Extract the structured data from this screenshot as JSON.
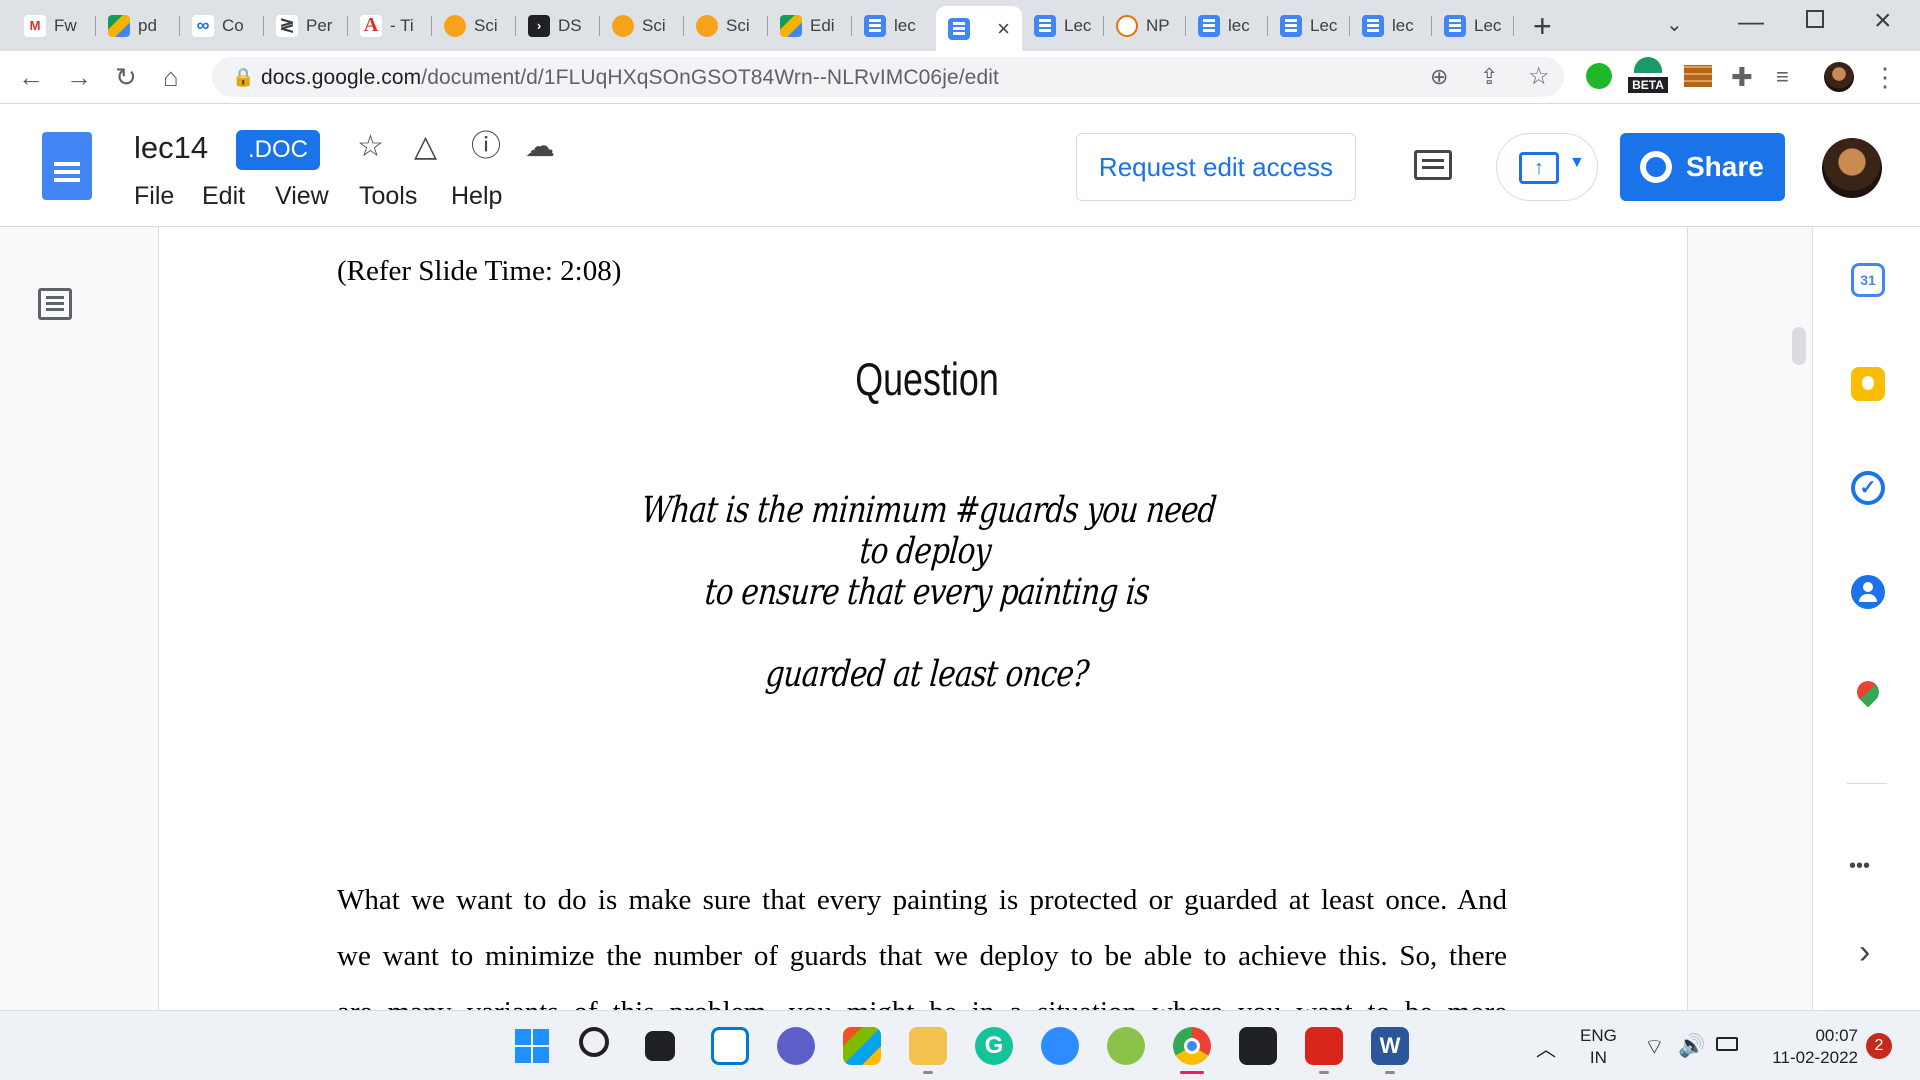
{
  "browser": {
    "tabs": [
      {
        "label": "Fw",
        "icon": "gmail-icon"
      },
      {
        "label": "pd",
        "icon": "google-drive-icon"
      },
      {
        "label": "Co",
        "icon": "link-icon"
      },
      {
        "label": "Per",
        "icon": "perplexity-icon"
      },
      {
        "label": "- Ti",
        "icon": "a-letter-icon"
      },
      {
        "label": "Sci",
        "icon": "scihub-icon"
      },
      {
        "label": "DS",
        "icon": "play-arrow-icon"
      },
      {
        "label": "Sci",
        "icon": "scihub-icon"
      },
      {
        "label": "Sci",
        "icon": "scihub-icon"
      },
      {
        "label": "Edi",
        "icon": "google-drive-icon"
      },
      {
        "label": "lec",
        "icon": "google-docs-icon"
      },
      {
        "label": "",
        "icon": "google-docs-icon",
        "active": true
      },
      {
        "label": "Lec",
        "icon": "google-docs-icon"
      },
      {
        "label": "NP",
        "icon": "nptel-icon"
      },
      {
        "label": "lec",
        "icon": "google-docs-icon"
      },
      {
        "label": "Lec",
        "icon": "google-docs-icon"
      },
      {
        "label": "lec",
        "icon": "google-docs-icon"
      },
      {
        "label": "Lec",
        "icon": "google-docs-icon"
      }
    ],
    "new_tab": "+",
    "url_host": "docs.google.com",
    "url_path": "/document/d/1FLUqHXqSOnGSOT84Wrn--NLRvIMC06je/edit",
    "beta_badge": "BETA"
  },
  "docs": {
    "title": "lec14",
    "badge": ".DOC",
    "menu": [
      "File",
      "Edit",
      "View",
      "Tools",
      "Help"
    ],
    "request_edit": "Request edit access",
    "share": "Share"
  },
  "document": {
    "slide_ref": "(Refer Slide Time: 2:08)",
    "slide_heading": "Question",
    "slide_lines": [
      "What is the minimum #guards you need to deploy",
      "to ensure that every painting is",
      "guarded at least once?"
    ],
    "paragraph_lines": [
      "What we want to do is make sure that every painting is protected or guarded at least once. And",
      "we want to minimize the number of guards that we deploy to be able to achieve this. So, there",
      "are many variants of this problem, you might be in a situation where you want to be more"
    ]
  },
  "side_panel": {
    "calendar_day": "31",
    "more": "•••",
    "expand": "›"
  },
  "taskbar": {
    "lang_line1": "ENG",
    "lang_line2": "IN",
    "time": "00:07",
    "date": "11-02-2022",
    "notifications": "2"
  },
  "colors": {
    "accent": "#1a73e8",
    "docs_blue": "#4285f4",
    "tab_bg": "#dee1e6"
  }
}
